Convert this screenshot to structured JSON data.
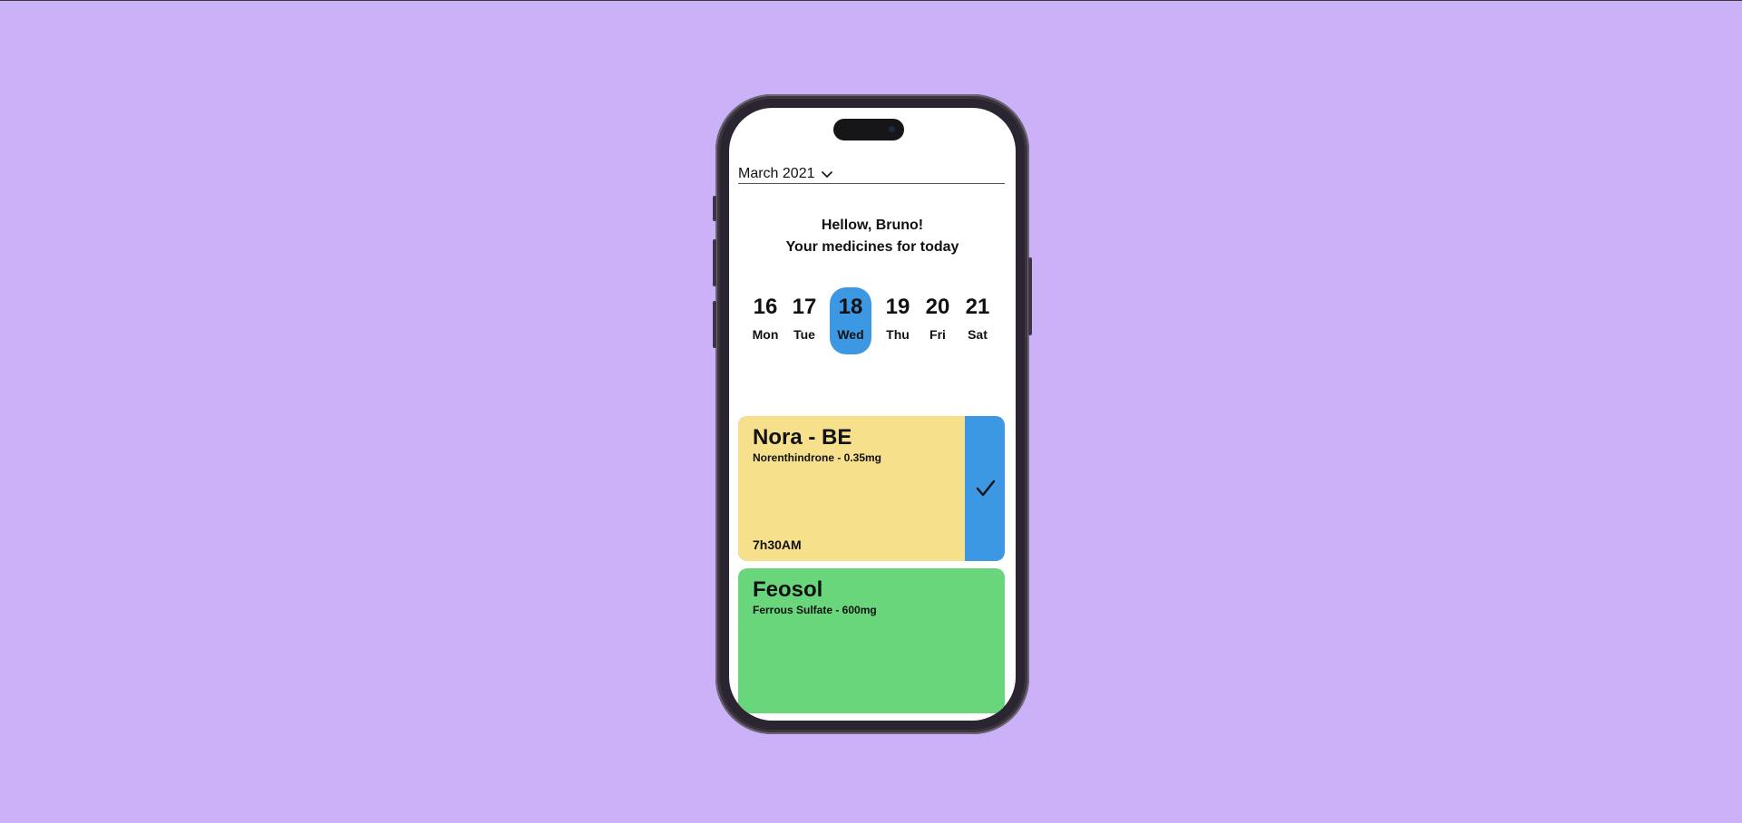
{
  "header": {
    "month_value": "March 2021",
    "dropdown_icon": "chevron-down-icon"
  },
  "greeting": {
    "line1": "Hellow, Bruno!",
    "line2": "Your medicines for today"
  },
  "week": {
    "days": [
      {
        "num": "16",
        "label": "Mon",
        "selected": false
      },
      {
        "num": "17",
        "label": "Tue",
        "selected": false
      },
      {
        "num": "18",
        "label": "Wed",
        "selected": true
      },
      {
        "num": "19",
        "label": "Thu",
        "selected": false
      },
      {
        "num": "20",
        "label": "Fri",
        "selected": false
      },
      {
        "num": "21",
        "label": "Sat",
        "selected": false
      }
    ]
  },
  "medicines": [
    {
      "name": "Nora - BE",
      "dose": "Norenthindrone - 0.35mg",
      "time": "7h30AM",
      "color": "#f7e08b",
      "action_color": "#3d98e4",
      "action_icon": "checkmark-icon"
    },
    {
      "name": "Feosol",
      "dose": "Ferrous Sulfate - 600mg",
      "color": "#69d67c"
    }
  ],
  "colors": {
    "background": "#cbb1f8",
    "accent": "#3d98e4"
  }
}
